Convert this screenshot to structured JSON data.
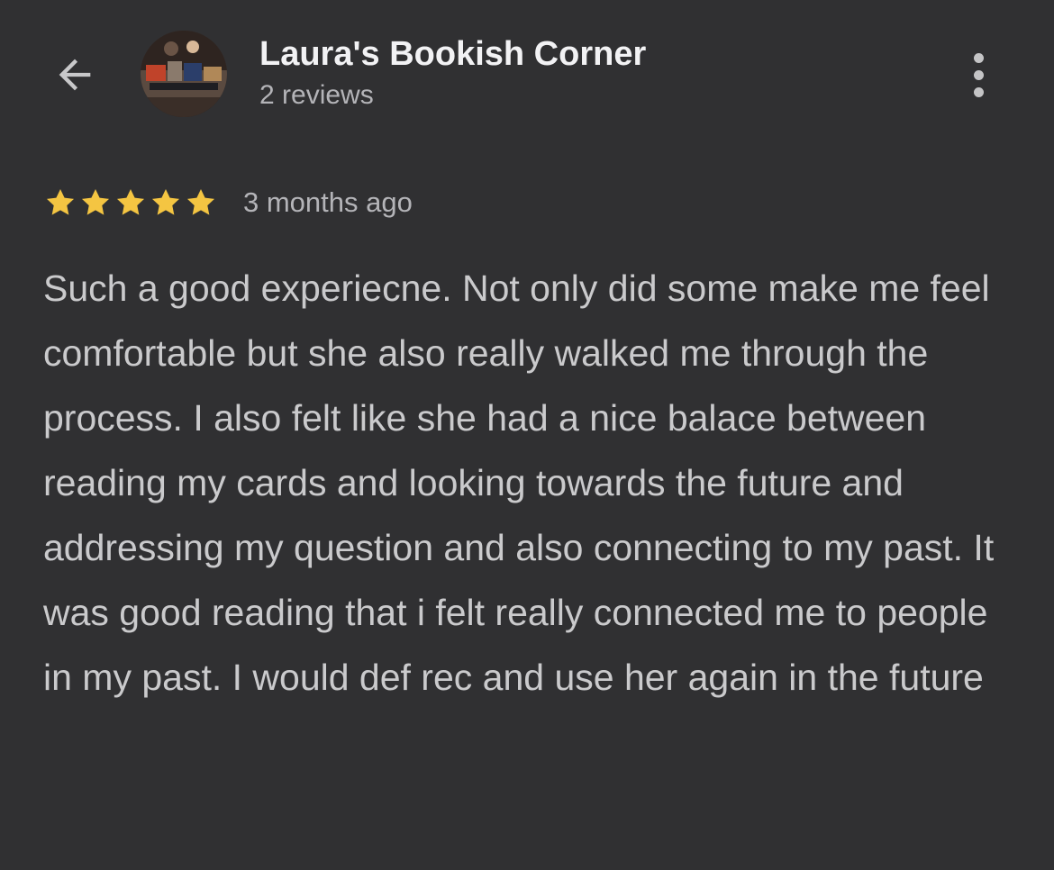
{
  "header": {
    "back_icon": "arrow-back-icon",
    "title": "Laura's Bookish Corner",
    "subtitle": "2 reviews",
    "more_icon": "more-vert-icon"
  },
  "review": {
    "rating": 5,
    "rating_max": 5,
    "star_color": "#f4c542",
    "time": "3 months ago",
    "text": "Such a good experiecne. Not only did some make me feel comfortable but she also really walked me through the process. I also felt like she had a nice balace between reading my cards and looking towards the future and addressing my question and also connecting to my past. It was good reading that i felt really connected me to people in my past. I would def rec and use her again in the future"
  },
  "colors": {
    "background": "#303032",
    "title": "#f2f2f4",
    "secondary_text": "#b4b4b8",
    "body_text": "#cacacc"
  }
}
